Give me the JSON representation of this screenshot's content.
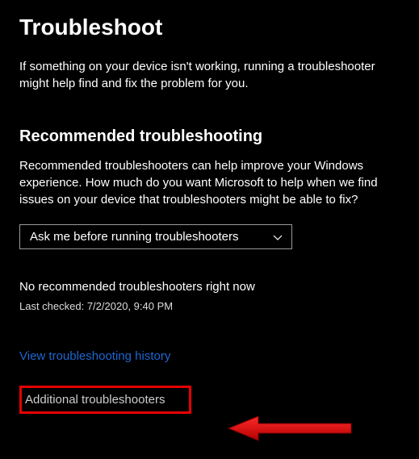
{
  "page_title": "Troubleshoot",
  "intro": "If something on your device isn't working, running a troubleshooter might help find and fix the problem for you.",
  "recommended": {
    "heading": "Recommended troubleshooting",
    "description": "Recommended troubleshooters can help improve your Windows experience. How much do you want Microsoft to help when we find issues on your device that troubleshooters might be able to fix?",
    "dropdown_value": "Ask me before running troubleshooters",
    "status": "No recommended troubleshooters right now",
    "last_checked": "Last checked: 7/2/2020, 9:40 PM"
  },
  "history_link": "View troubleshooting history",
  "additional_link": "Additional troubleshooters"
}
